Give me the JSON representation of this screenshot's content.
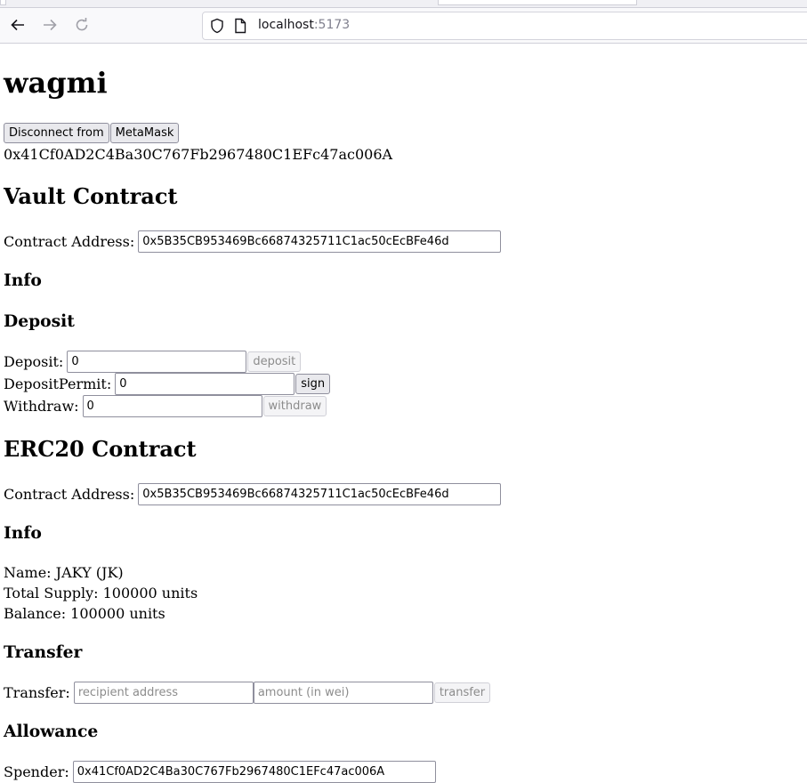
{
  "browser": {
    "url_host": "localhost",
    "url_port": ":5173"
  },
  "app": {
    "title": "wagmi",
    "disconnect_label": "Disconnect from",
    "metamask_label": "MetaMask",
    "account_address": "0x41Cf0AD2C4Ba30C767Fb2967480C1EFc47ac006A"
  },
  "vault": {
    "heading": "Vault Contract",
    "contract_address_label": "Contract Address:",
    "contract_address_value": "0x5B35CB953469Bc66874325711C1ac50cEcBFe46d",
    "info_heading": "Info",
    "deposit_heading": "Deposit",
    "deposit_label": "Deposit:",
    "deposit_value": "0",
    "deposit_button": "deposit",
    "deposit_permit_label": "DepositPermit:",
    "deposit_permit_value": "0",
    "sign_button": "sign",
    "withdraw_label": "Withdraw:",
    "withdraw_value": "0",
    "withdraw_button": "withdraw"
  },
  "erc20": {
    "heading": "ERC20 Contract",
    "contract_address_label": "Contract Address:",
    "contract_address_value": "0x5B35CB953469Bc66874325711C1ac50cEcBFe46d",
    "info_heading": "Info",
    "name_line": "Name: JAKY (JK)",
    "total_supply_line": "Total Supply: 100000 units",
    "balance_line": "Balance: 100000 units",
    "transfer_heading": "Transfer",
    "transfer_label": "Transfer:",
    "recipient_placeholder": "recipient address",
    "amount_placeholder": "amount (in wei)",
    "transfer_button": "transfer",
    "allowance_heading": "Allowance",
    "spender_label": "Spender:",
    "spender_value": "0x41Cf0AD2C4Ba30C767Fb2967480C1EFc47ac006A"
  }
}
